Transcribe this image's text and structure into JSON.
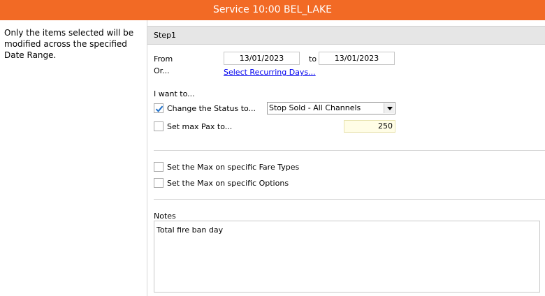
{
  "window": {
    "title": "Service 10:00 BEL_LAKE"
  },
  "sidebar": {
    "note": "Only the items selected will be modified across the specified Date Range."
  },
  "step": {
    "label": "Step1"
  },
  "dates": {
    "from_label": "From",
    "from_value": "13/01/2023",
    "to_label": "to",
    "to_value": "13/01/2023",
    "or_label": "Or...",
    "recurring_link": "Select Recurring Days..."
  },
  "options": {
    "intro": "I want to...",
    "change_status": {
      "label": "Change the Status to...",
      "checked": true,
      "selected": "Stop Sold - All Channels"
    },
    "max_pax": {
      "label": "Set max Pax to...",
      "checked": false,
      "value": "250"
    },
    "fare_types": {
      "label": "Set the Max on specific Fare Types",
      "checked": false
    },
    "specific_options": {
      "label": "Set the Max on specific Options",
      "checked": false
    }
  },
  "notes": {
    "label": "Notes",
    "value": "Total fire ban day"
  },
  "colors": {
    "titlebar": "#f26a25",
    "check": "#1e6fc8",
    "link": "#0000ee",
    "pax_field": "#fffde6"
  }
}
